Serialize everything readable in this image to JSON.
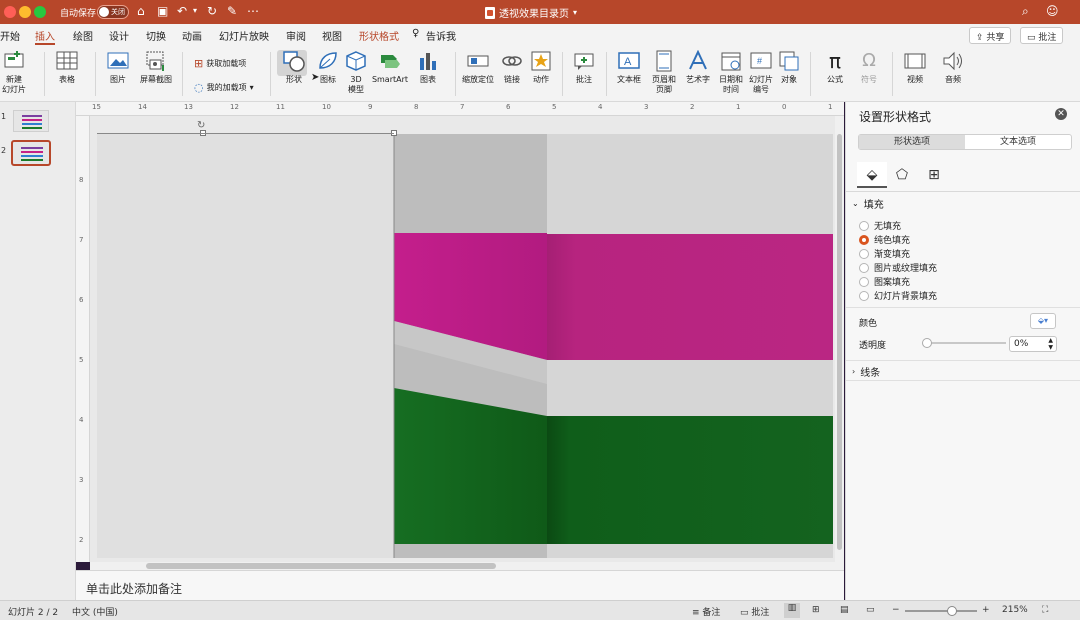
{
  "app": {
    "autosave_label": "自动保存",
    "autosave_state": "关闭",
    "doc_title": "透视效果目录页"
  },
  "tabs": [
    "开始",
    "插入",
    "绘图",
    "设计",
    "切换",
    "动画",
    "幻灯片放映",
    "审阅",
    "视图",
    "形状格式",
    "告诉我"
  ],
  "active_tab": "插入",
  "header_buttons": {
    "share": "共享",
    "comment": "批注"
  },
  "ribbon": {
    "new_slide": "新建\n幻灯片",
    "table": "表格",
    "picture": "图片",
    "screenshot": "屏幕截图",
    "get_addins": "获取加载项",
    "my_addins": "我的加载项",
    "shapes": "形状",
    "icons": "图标",
    "model3d": "3D\n模型",
    "smartart": "SmartArt",
    "chart": "图表",
    "zoom": "缩放定位",
    "link": "链接",
    "action": "动作",
    "comment": "批注",
    "textbox": "文本框",
    "header_footer": "页眉和\n页脚",
    "wordart": "艺术字",
    "datetime": "日期和\n时间",
    "slide_number": "幻灯片\n编号",
    "object": "对象",
    "equation": "公式",
    "symbol": "符号",
    "video": "视频",
    "audio": "音频"
  },
  "slides": [
    {
      "num": "1",
      "colors": [
        "#7b3fa0",
        "#c52187",
        "#2f7fd0",
        "#1a7a2a"
      ]
    },
    {
      "num": "2",
      "colors": [
        "#7b3fa0",
        "#c52187",
        "#2f7fd0",
        "#1a7a2a"
      ]
    }
  ],
  "ruler_h": [
    "15",
    "14",
    "13",
    "12",
    "11",
    "10",
    "9",
    "8",
    "7",
    "6",
    "5",
    "4",
    "3",
    "2",
    "1",
    "0",
    "1"
  ],
  "ruler_v": [
    "8",
    "7",
    "6",
    "5",
    "4",
    "3",
    "2"
  ],
  "slide_colors": {
    "gray_light": "#d6d6d6",
    "gray_mid": "#bdbdbd",
    "magenta_side": "#c41e8c",
    "magenta_front": "#b7247f",
    "green_side": "#146b1f",
    "green_front": "#0f5e1a"
  },
  "notes_placeholder": "单击此处添加备注",
  "status": {
    "slide_info": "幻灯片 2 / 2",
    "language": "中文 (中国)",
    "notes": "备注",
    "comments": "批注",
    "zoom": "215%"
  },
  "format_pane": {
    "title": "设置形状格式",
    "tab_shape": "形状选项",
    "tab_text": "文本选项",
    "fill_header": "填充",
    "fill_options": [
      "无填充",
      "纯色填充",
      "渐变填充",
      "图片或纹理填充",
      "图案填充",
      "幻灯片背景填充"
    ],
    "selected_fill": "纯色填充",
    "color_label": "颜色",
    "transparency_label": "透明度",
    "transparency_value": "0%",
    "line_header": "线条"
  }
}
